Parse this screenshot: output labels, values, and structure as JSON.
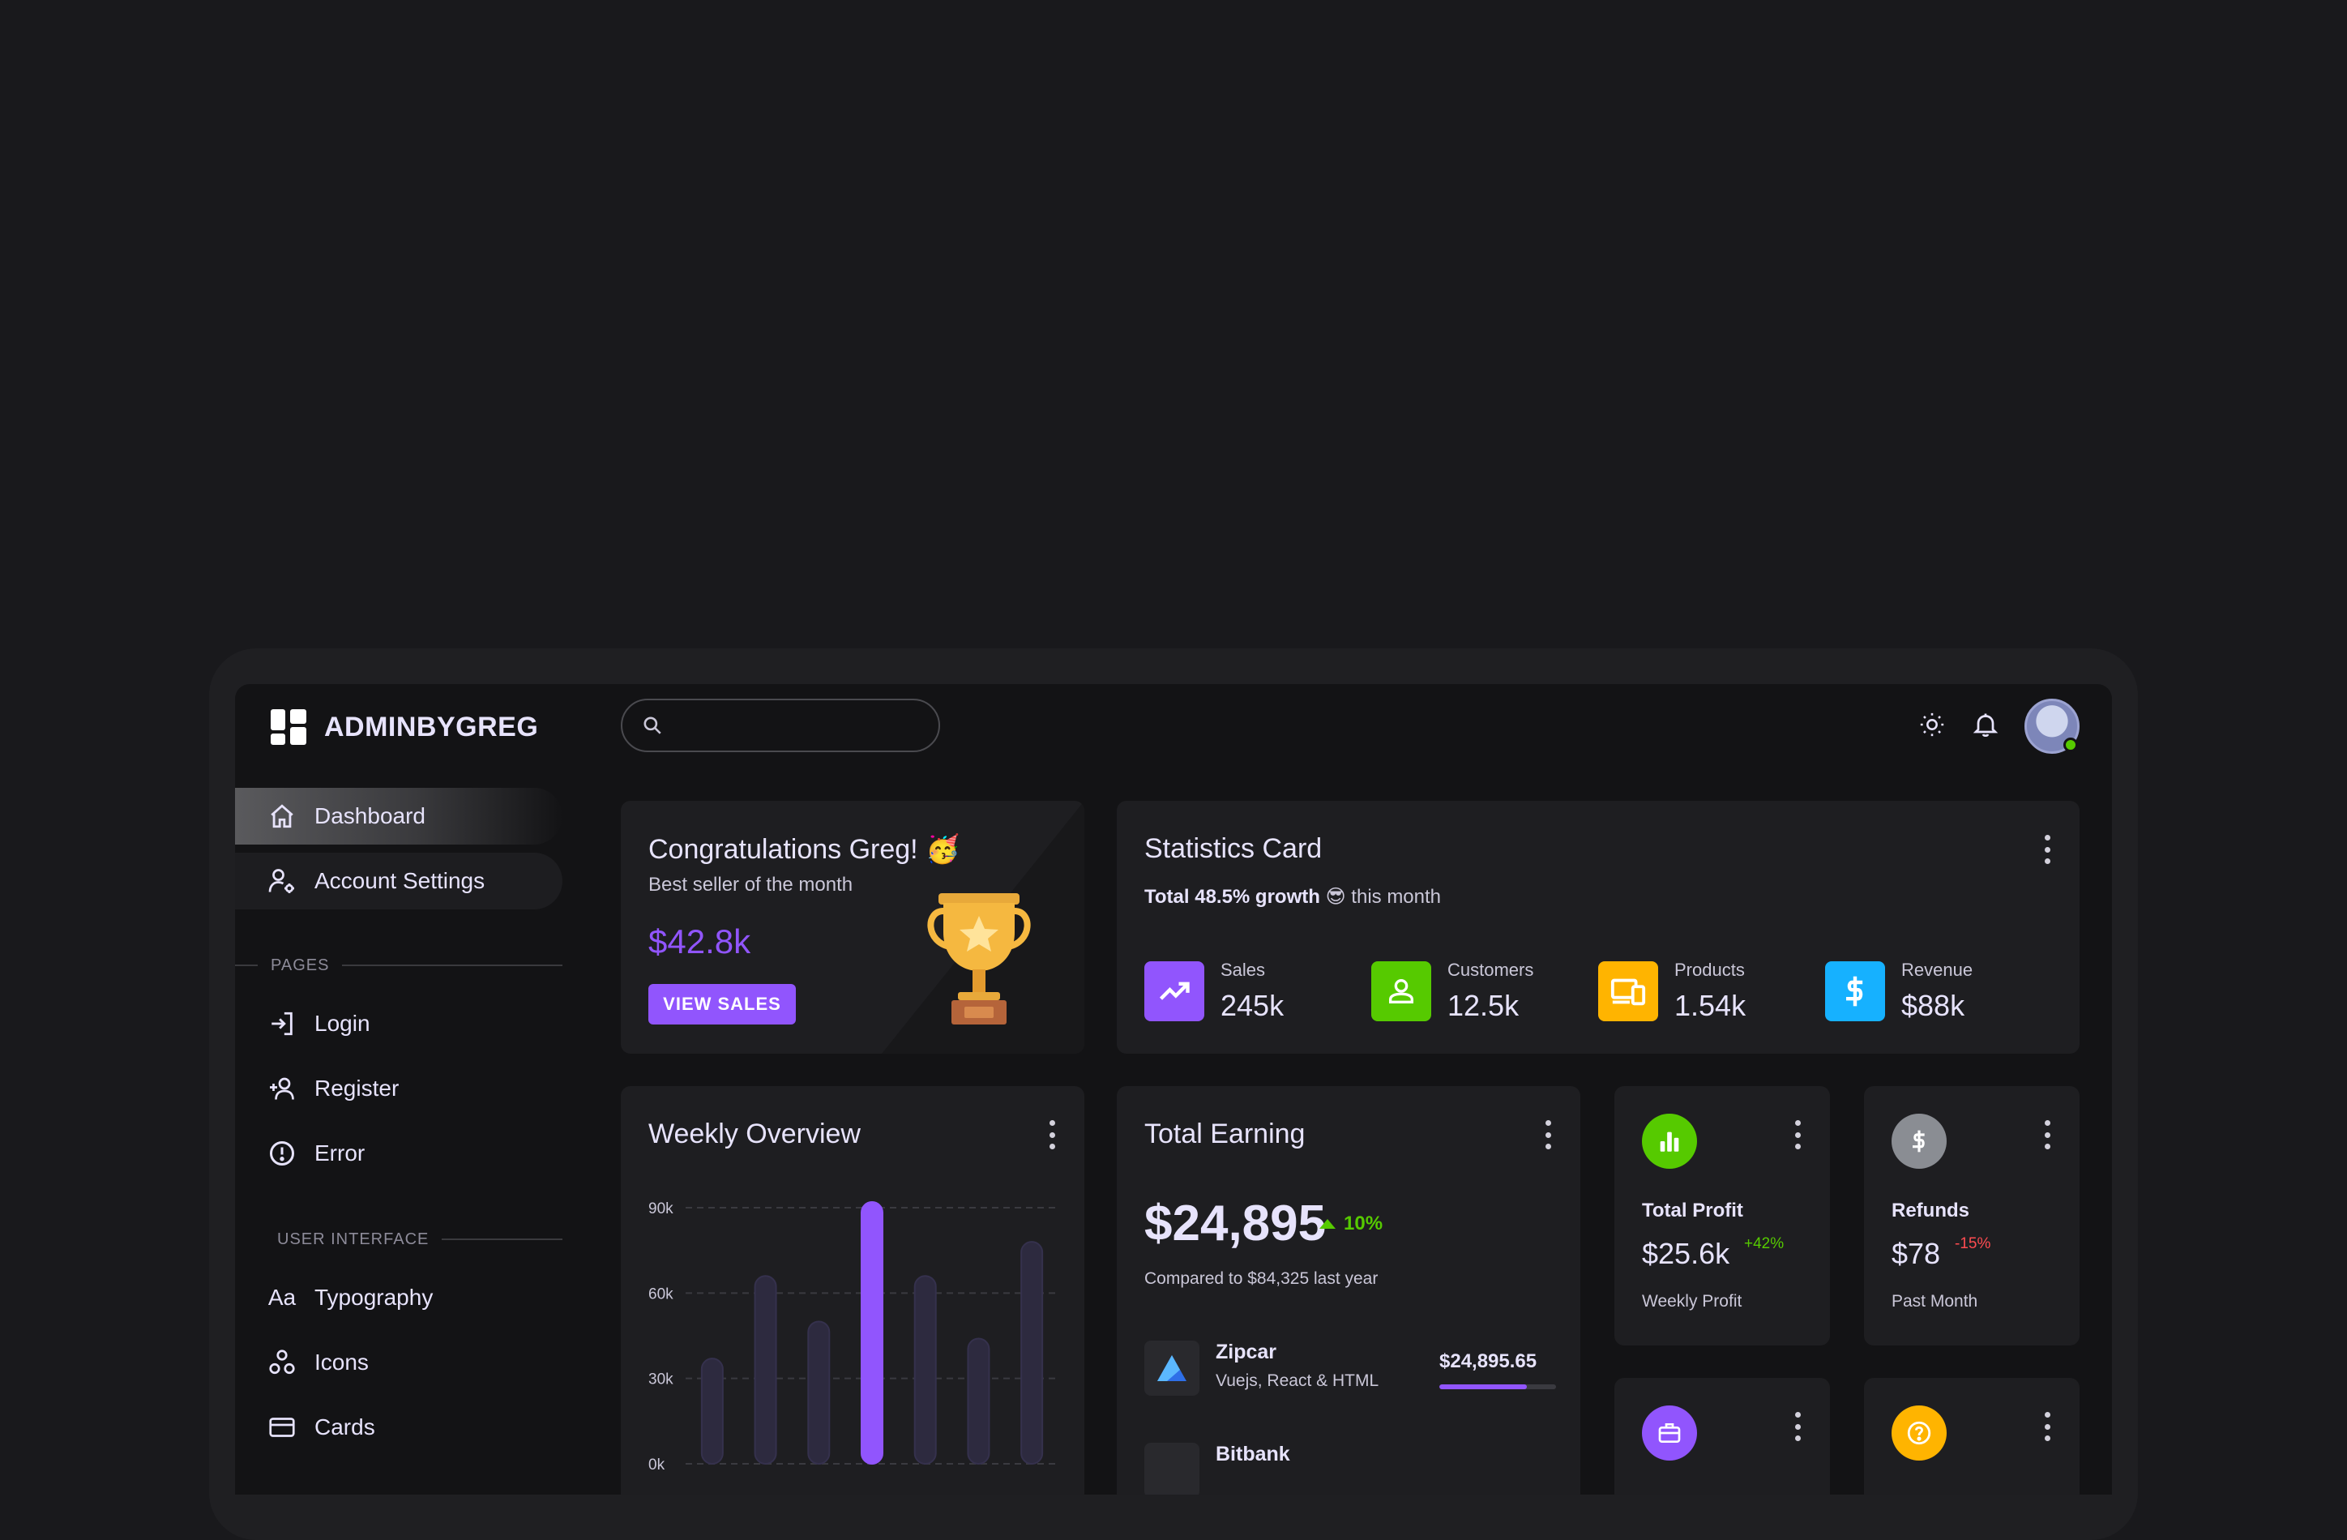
{
  "brand": {
    "name": "ADMINBYGREG"
  },
  "search": {
    "placeholder": ""
  },
  "sidebar": {
    "items": [
      {
        "label": "Dashboard"
      },
      {
        "label": "Account Settings"
      }
    ],
    "pages_title": "PAGES",
    "pages": [
      {
        "label": "Login"
      },
      {
        "label": "Register"
      },
      {
        "label": "Error"
      }
    ],
    "ui_title": "USER INTERFACE",
    "ui": [
      {
        "label": "Typography",
        "icon_text": "Aa"
      },
      {
        "label": "Icons"
      },
      {
        "label": "Cards"
      }
    ]
  },
  "congrats": {
    "title": "Congratulations Greg! 🥳",
    "subtitle": "Best seller of the month",
    "amount": "$42.8k",
    "button": "VIEW SALES"
  },
  "statistics": {
    "title": "Statistics Card",
    "growth_bold": "Total 48.5% growth",
    "growth_emoji": "😎",
    "growth_rest": "this month",
    "stats": [
      {
        "label": "Sales",
        "value": "245k",
        "color": "#9155fd"
      },
      {
        "label": "Customers",
        "value": "12.5k",
        "color": "#56ca00"
      },
      {
        "label": "Products",
        "value": "1.54k",
        "color": "#ffb400"
      },
      {
        "label": "Revenue",
        "value": "$88k",
        "color": "#16b1ff"
      }
    ]
  },
  "weekly": {
    "title": "Weekly Overview"
  },
  "chart_data": {
    "type": "bar",
    "categories": [
      "",
      "",
      "",
      "",
      "",
      "",
      ""
    ],
    "values": [
      37,
      66,
      50,
      92,
      66,
      44,
      78
    ],
    "highlight_index": 3,
    "yticks": [
      "0k",
      "30k",
      "60k",
      "90k"
    ],
    "ylim": [
      0,
      90
    ],
    "grid": true
  },
  "earning": {
    "title": "Total Earning",
    "amount": "$24,895",
    "change": "10%",
    "compare": "Compared to $84,325 last year",
    "items": [
      {
        "name": "Zipcar",
        "tech": "Vuejs, React & HTML",
        "amount": "$24,895.65",
        "progress": 75
      },
      {
        "name": "Bitbank"
      }
    ]
  },
  "profit": {
    "title": "Total Profit",
    "value": "$25.6k",
    "change": "+42%",
    "sub": "Weekly Profit"
  },
  "refunds": {
    "title": "Refunds",
    "value": "$78",
    "change": "-15%",
    "sub": "Past Month"
  }
}
